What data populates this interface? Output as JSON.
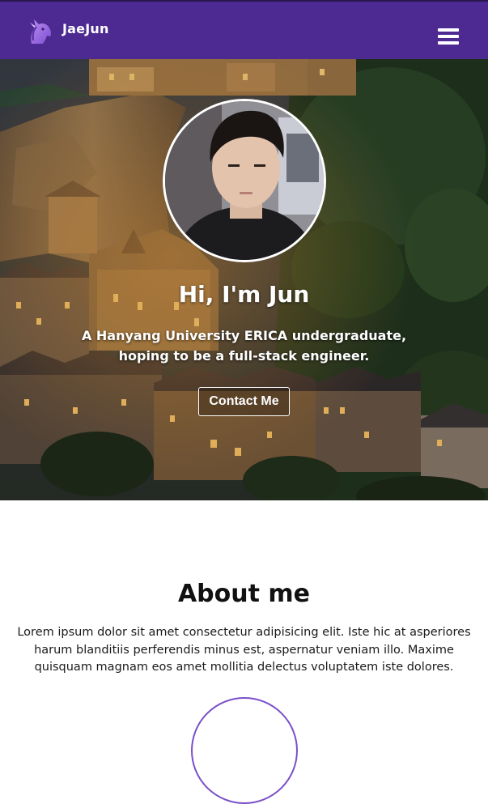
{
  "navbar": {
    "brand": "JaeJun",
    "logo_icon": "unicorn-icon",
    "menu_icon": "hamburger-menu-icon",
    "background_color": "#4c2a92"
  },
  "hero": {
    "title": "Hi, I'm Jun",
    "subtitle": "A Hanyang University ERICA undergraduate, hoping to be a full-stack engineer.",
    "contact_button": "Contact Me"
  },
  "about": {
    "title": "About me",
    "text": "Lorem ipsum dolor sit amet consectetur adipisicing elit. Iste hic at asperiores harum blanditiis perferendis minus est, aspernatur veniam illo. Maxime quisquam magnam eos amet mollitia delectus voluptatem iste dolores.",
    "accent_color": "#7a4fc9"
  }
}
